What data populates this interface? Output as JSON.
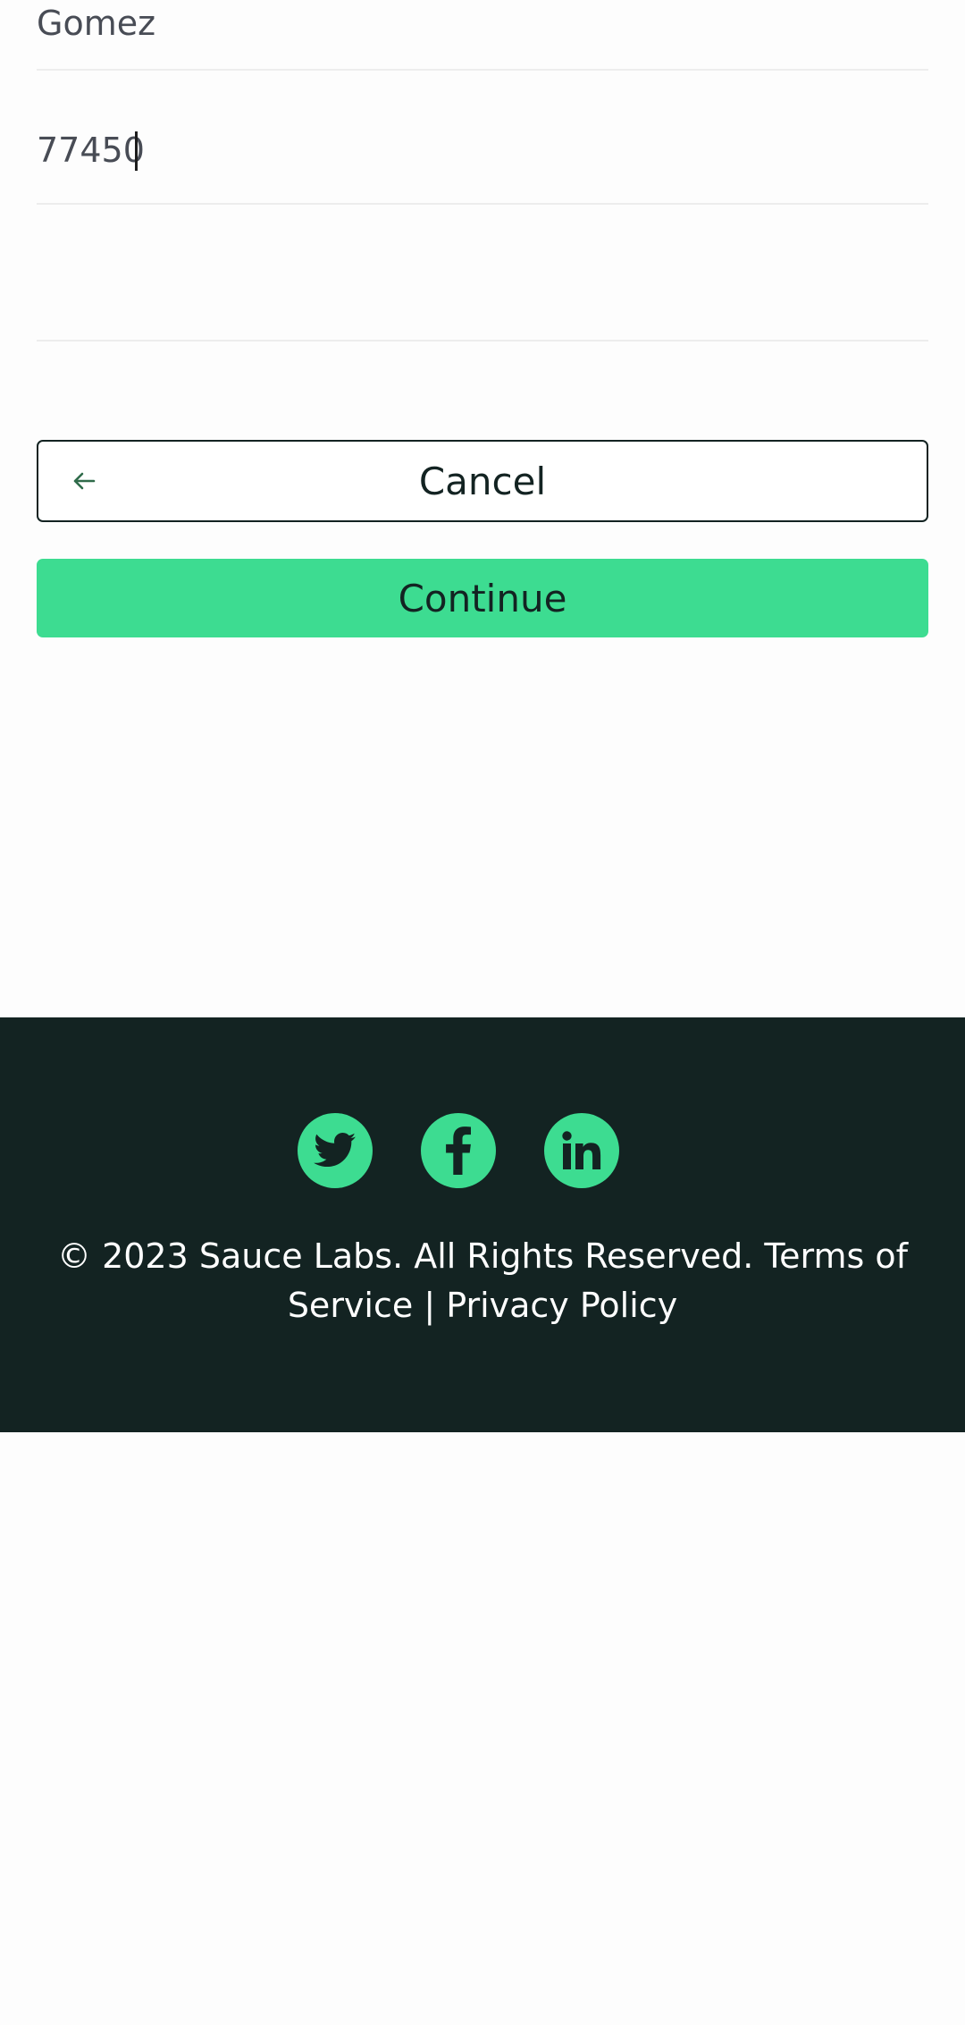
{
  "form": {
    "last_name_value": "Gomez",
    "zip_value": "77450",
    "extra_value": ""
  },
  "buttons": {
    "cancel_label": "Cancel",
    "continue_label": "Continue"
  },
  "footer": {
    "copyright": "© 2023 Sauce Labs. All Rights Reserved. Terms of Service | Privacy Policy",
    "social": [
      "twitter-icon",
      "facebook-icon",
      "linkedin-icon"
    ]
  },
  "colors": {
    "accent": "#3ddc91",
    "footer_bg": "#132322",
    "text_dark": "#132322",
    "input_text": "#484c55"
  }
}
